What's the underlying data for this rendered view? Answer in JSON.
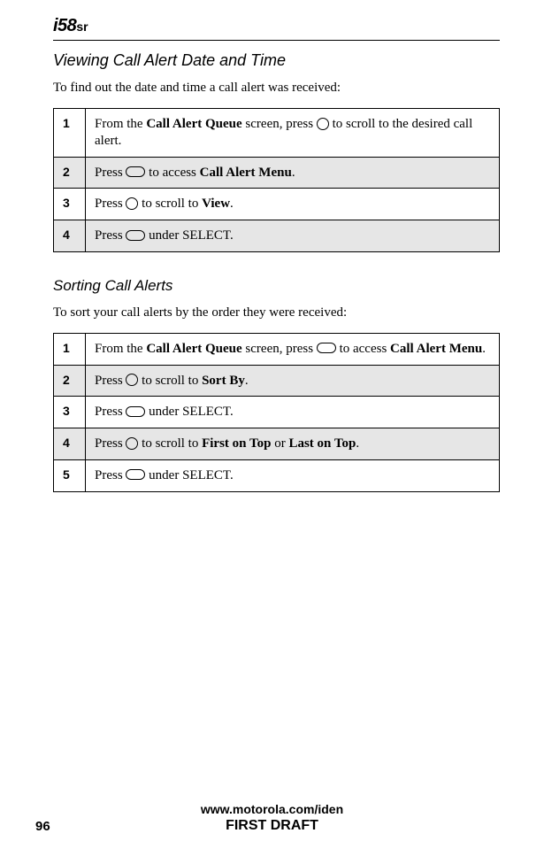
{
  "header": {
    "model": "i58",
    "suffix": "sr"
  },
  "section1": {
    "title": "Viewing Call Alert Date and Time",
    "intro": "To find out the date and time a call alert was received:",
    "steps": [
      {
        "n": "1",
        "pre": "From the ",
        "bold1": "Call Alert Queue",
        "mid": " screen, press ",
        "icon": "round",
        "post": " to scroll to the desired call alert."
      },
      {
        "n": "2",
        "pre": "Press ",
        "icon": "oval",
        "mid": " to access ",
        "bold1": "Call Alert Menu",
        "post": "."
      },
      {
        "n": "3",
        "pre": "Press ",
        "icon": "round",
        "mid": " to scroll to ",
        "bold1": "View",
        "post": "."
      },
      {
        "n": "4",
        "pre": "Press ",
        "icon": "oval",
        "post": " under SELECT."
      }
    ]
  },
  "section2": {
    "title": "Sorting Call Alerts",
    "intro": "To sort your call alerts by the order they were received:",
    "steps": [
      {
        "n": "1",
        "pre": "From the ",
        "bold1": "Call Alert Queue",
        "mid1": " screen, press ",
        "icon": "oval",
        "mid2": " to access ",
        "bold2": "Call Alert Menu",
        "post": "."
      },
      {
        "n": "2",
        "pre": "Press ",
        "icon": "round",
        "mid": " to scroll to ",
        "bold1": "Sort By",
        "post": "."
      },
      {
        "n": "3",
        "pre": "Press ",
        "icon": "oval",
        "post": " under SELECT."
      },
      {
        "n": "4",
        "pre": "Press ",
        "icon": "round",
        "mid1": " to scroll to ",
        "bold1": "First on Top",
        "mid2": " or ",
        "bold2": "Last on Top",
        "post": "."
      },
      {
        "n": "5",
        "pre": "Press ",
        "icon": "oval",
        "post": " under SELECT."
      }
    ]
  },
  "footer": {
    "url": "www.motorola.com/iden",
    "page": "96",
    "draft": "FIRST DRAFT"
  }
}
